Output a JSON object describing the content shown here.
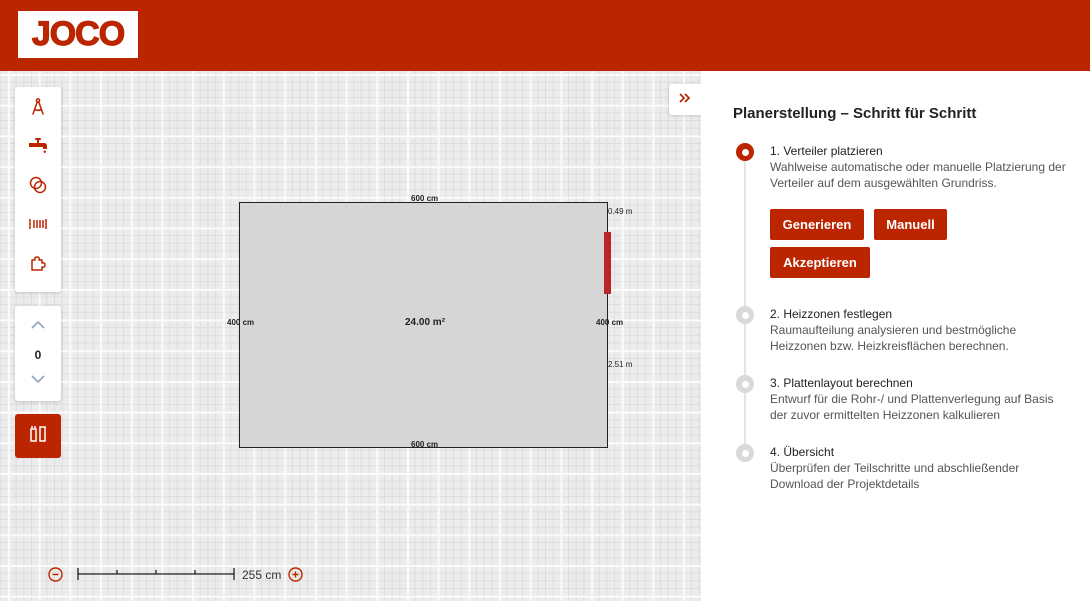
{
  "header": {
    "logo_text": "JOCO"
  },
  "toolbar": {
    "tools": [
      {
        "icon": "compass-draw-icon"
      },
      {
        "icon": "faucet-icon"
      },
      {
        "icon": "circles-icon"
      },
      {
        "icon": "radiator-icon"
      },
      {
        "icon": "puzzle-icon"
      }
    ]
  },
  "level": {
    "value": "0"
  },
  "floorplan": {
    "top_label": "600 cm",
    "bottom_label": "600 cm",
    "left_label": "400 cm",
    "right_label": "400 cm",
    "area": "24.00 m²",
    "offset_top": "0.49 m",
    "offset_bottom": "2.51 m"
  },
  "scale": {
    "label": "255 cm"
  },
  "steps_panel": {
    "title": "Planerstellung – Schritt für Schritt",
    "steps": [
      {
        "title": "1. Verteiler platzieren",
        "desc": "Wahlweise automatische oder manuelle Platzierung der Verteiler auf dem ausgewählten Grundriss.",
        "active": true
      },
      {
        "title": "2. Heizzonen festlegen",
        "desc": "Raumaufteilung analysieren und bestmögliche Heizzonen bzw. Heizkreisflächen berechnen.",
        "active": false
      },
      {
        "title": "3. Plattenlayout berechnen",
        "desc": "Entwurf für die Rohr-/ und Plattenverlegung auf Basis der zuvor ermittelten Heizzonen kalkulieren",
        "active": false
      },
      {
        "title": "4. Übersicht",
        "desc": "Überprüfen der Teilschritte und abschließender Download der Projektdetails",
        "active": false
      }
    ],
    "buttons": {
      "generate": "Generieren",
      "manual": "Manuell",
      "accept": "Akzeptieren"
    }
  },
  "colors": {
    "brand": "#bb2500",
    "inactive_step": "#d9d9d9",
    "distributor": "#b8262a"
  }
}
